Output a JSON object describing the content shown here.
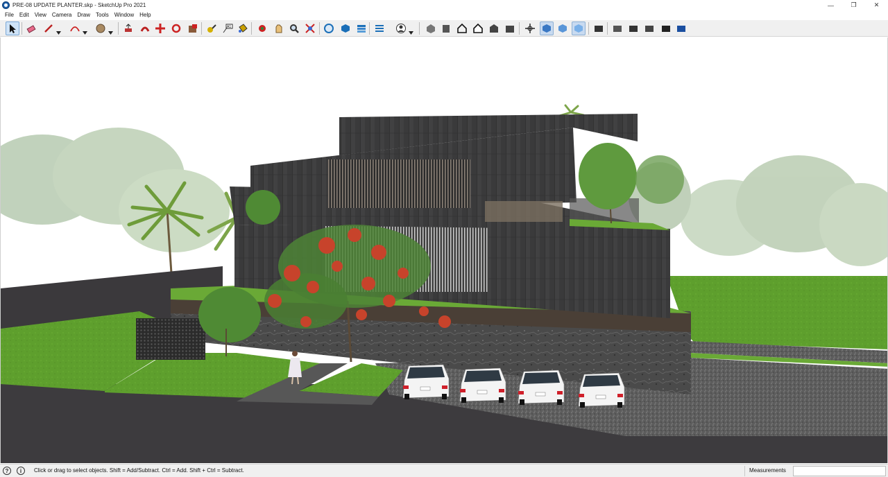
{
  "window": {
    "title": "PRE-08 UPDATE PLANTER.skp - SketchUp Pro 2021",
    "minimize_glyph": "—",
    "restore_glyph": "❐",
    "close_glyph": "✕"
  },
  "menu": {
    "items": [
      "File",
      "Edit",
      "View",
      "Camera",
      "Draw",
      "Tools",
      "Window",
      "Help"
    ]
  },
  "toolbar": {
    "tools": [
      {
        "icon": "select-arrow-icon",
        "active": true
      },
      {
        "icon": "eraser-icon"
      },
      {
        "icon": "line-pencil-icon",
        "dropdown": true
      },
      {
        "icon": "arc-icon",
        "dropdown": true
      },
      {
        "icon": "shapes-circle-icon",
        "dropdown": true
      },
      {
        "icon": "push-pull-icon"
      },
      {
        "icon": "offset-icon"
      },
      {
        "icon": "move-icon"
      },
      {
        "icon": "rotate-icon"
      },
      {
        "icon": "scale-icon"
      },
      {
        "icon": "tape-measure-icon"
      },
      {
        "icon": "text-label-icon"
      },
      {
        "icon": "paint-bucket-icon"
      },
      {
        "icon": "orbit-icon"
      },
      {
        "icon": "pan-hand-icon"
      },
      {
        "icon": "zoom-icon"
      },
      {
        "icon": "zoom-extents-icon"
      },
      {
        "icon": "3d-warehouse-icon"
      },
      {
        "icon": "extension-warehouse-icon"
      },
      {
        "icon": "layout-icon"
      },
      {
        "icon": "extension-manager-icon"
      },
      {
        "icon": "account-icon",
        "dropdown": true
      },
      {
        "icon": "iso-view-icon"
      },
      {
        "icon": "top-view-icon"
      },
      {
        "icon": "front-view-icon"
      },
      {
        "icon": "right-view-icon"
      },
      {
        "icon": "back-view-icon"
      },
      {
        "icon": "left-view-icon"
      },
      {
        "icon": "xray-icon"
      },
      {
        "icon": "back-edges-icon",
        "pressed": true
      },
      {
        "icon": "wireframe-icon"
      },
      {
        "icon": "hidden-line-icon",
        "pressed": true
      },
      {
        "icon": "shaded-icon"
      },
      {
        "icon": "shaded-textures-icon"
      },
      {
        "icon": "monochrome-icon"
      },
      {
        "icon": "style-a-icon"
      },
      {
        "icon": "style-b-icon"
      },
      {
        "icon": "style-c-icon"
      }
    ]
  },
  "status": {
    "hint": "Click or drag to select objects. Shift = Add/Subtract. Ctrl = Add. Shift + Ctrl = Subtract.",
    "geo_icon": "geo-location-icon",
    "info_icon": "info-icon",
    "measurements_label": "Measurements",
    "measurements_value": ""
  },
  "scene": {
    "sky": "#ffffff",
    "facade": "#3a3a3b",
    "lawn": "#5fa02e",
    "road": "#3c3a3c",
    "gravel": "#5a5a5a",
    "car_count": 4
  }
}
